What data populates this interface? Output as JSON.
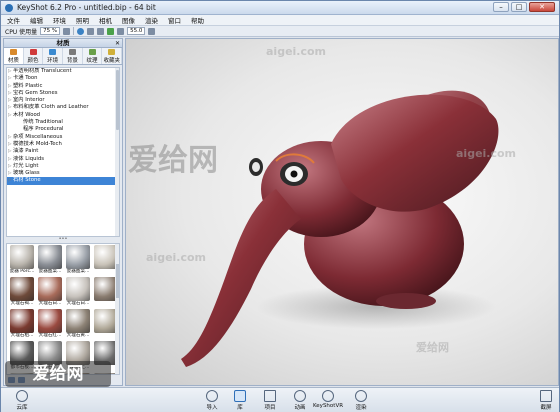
{
  "window": {
    "title": "KeyShot 6.2 Pro - untitled.bip - 64 bit",
    "min": "–",
    "max": "□",
    "close": "✕"
  },
  "menu": [
    "文件",
    "编辑",
    "环境",
    "照明",
    "相机",
    "图像",
    "渲染",
    "窗口",
    "帮助"
  ],
  "toolbar": {
    "cpu_label": "CPU 使用量",
    "cpu_value": "75 %",
    "fps_value": "55.0"
  },
  "panel": {
    "title": "材质",
    "close": "✕",
    "tabs": [
      {
        "label": "材质",
        "color": "#d98a2c"
      },
      {
        "label": "颜色",
        "color": "#d03a3a"
      },
      {
        "label": "环境",
        "color": "#3a8ad0"
      },
      {
        "label": "背景",
        "color": "#7a7a7a"
      },
      {
        "label": "纹理",
        "color": "#6aa04a"
      },
      {
        "label": "收藏夹",
        "color": "#d0b03a"
      }
    ],
    "tree": [
      {
        "label": "半透明材质 Translucent",
        "child": false
      },
      {
        "label": "卡通 Toon",
        "child": false
      },
      {
        "label": "塑料 Plastic",
        "child": false
      },
      {
        "label": "宝石 Gem Stones",
        "child": false
      },
      {
        "label": "室内 Interior",
        "child": false
      },
      {
        "label": "布料和皮革 Cloth and Leather",
        "child": false
      },
      {
        "label": "木材 Wood",
        "child": false
      },
      {
        "label": "传统 Traditional",
        "child": true
      },
      {
        "label": "程序 Procedural",
        "child": true
      },
      {
        "label": "杂项 Miscellaneous",
        "child": false
      },
      {
        "label": "模德技术 Mold-Tech",
        "child": false
      },
      {
        "label": "油漆 Paint",
        "child": false
      },
      {
        "label": "液体 Liquids",
        "child": false
      },
      {
        "label": "灯光 Light",
        "child": false
      },
      {
        "label": "玻璃 Glass",
        "child": false
      },
      {
        "label": "石材 Stone",
        "child": false,
        "selected": true
      }
    ],
    "splitter": "•••",
    "materials": [
      {
        "label": "瓷器 Porc...",
        "color": "#b9b4ac"
      },
      {
        "label": "瓷器图案...",
        "color": "#8b8f96"
      },
      {
        "label": "瓷器图案...",
        "color": "#9aa0a8"
      },
      {
        "label": "",
        "color": "#c9c3b8"
      },
      {
        "label": "大理石褐...",
        "color": "#6e4a3a"
      },
      {
        "label": "大理石白...",
        "color": "#a86b5a"
      },
      {
        "label": "大理石白...",
        "color": "#c7c2bc"
      },
      {
        "label": "",
        "color": "#8a7c70"
      },
      {
        "label": "大理石粗...",
        "color": "#7a3a30"
      },
      {
        "label": "大理石红...",
        "color": "#9a4a40"
      },
      {
        "label": "大理石黄...",
        "color": "#8d8275"
      },
      {
        "label": "",
        "color": "#b0a898"
      },
      {
        "label": "都市石板...",
        "color": "#5a5a5a"
      },
      {
        "label": "翻砂石土...",
        "color": "#8b8b8b"
      },
      {
        "label": "翻砂石土...",
        "color": "#b0a9a0"
      },
      {
        "label": "",
        "color": "#6c6c6c"
      },
      {
        "label": "干净的花...",
        "color": "#9b978f"
      },
      {
        "label": "...地板石...",
        "color": "#7b6a5c"
      },
      {
        "label": "...花岗岩...",
        "color": "#a09080"
      },
      {
        "label": "",
        "color": "#908a84"
      }
    ]
  },
  "bottombar": [
    {
      "label": "云库",
      "icon": "cloud-icon"
    },
    {
      "label": "导入",
      "icon": "import-icon"
    },
    {
      "label": "库",
      "icon": "library-icon"
    },
    {
      "label": "项目",
      "icon": "project-icon"
    },
    {
      "label": "动画",
      "icon": "animation-icon"
    },
    {
      "label": "KeyShotVR",
      "icon": "vr-icon"
    },
    {
      "label": "渲染",
      "icon": "render-icon"
    },
    {
      "label": "截屏",
      "icon": "screenshot-icon"
    }
  ],
  "watermarks": {
    "brand": "爱给网",
    "domain": "aigei.com"
  }
}
